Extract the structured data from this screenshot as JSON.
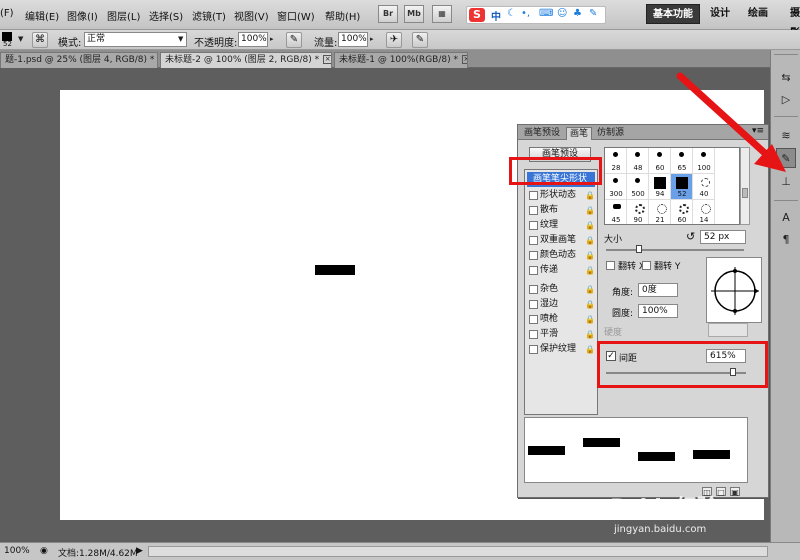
{
  "menubar": {
    "items": [
      "(F)",
      "编辑(E)",
      "图像(I)",
      "图层(L)",
      "选择(S)",
      "滤镜(T)",
      "视图(V)",
      "窗口(W)",
      "帮助(H)"
    ],
    "br_label": "Br",
    "mb_label": "Mb",
    "sogou_mode": "中",
    "workspaces": [
      "基本功能",
      "设计",
      "绘画",
      "摄影"
    ],
    "active_workspace": "基本功能"
  },
  "options": {
    "brush_size": "52",
    "mode_label": "模式:",
    "mode_value": "正常",
    "opacity_label": "不透明度:",
    "opacity_value": "100%",
    "flow_label": "流量:",
    "flow_value": "100%"
  },
  "tabs": [
    {
      "label": "题-1.psd @ 25% (图层 4, RGB/8) *",
      "active": false
    },
    {
      "label": "未标题-2 @ 100% (图层 2, RGB/8) *",
      "active": true
    },
    {
      "label": "未标题-1 @ 100%(RGB/8) *",
      "active": false
    }
  ],
  "brush_panel": {
    "tabs": [
      "画笔预设",
      "画笔",
      "仿制源"
    ],
    "active_tab": "画笔",
    "presets_button": "画笔预设",
    "options": [
      {
        "label": "画笔笔尖形状",
        "checkbox": false,
        "lock": false,
        "selected": true
      },
      {
        "label": "形状动态",
        "checkbox": true,
        "lock": true
      },
      {
        "label": "散布",
        "checkbox": true,
        "lock": true
      },
      {
        "label": "纹理",
        "checkbox": true,
        "lock": true
      },
      {
        "label": "双重画笔",
        "checkbox": true,
        "lock": true
      },
      {
        "label": "颜色动态",
        "checkbox": true,
        "lock": true
      },
      {
        "label": "传递",
        "checkbox": true,
        "lock": true
      },
      {
        "label": "杂色",
        "checkbox": true,
        "lock": true
      },
      {
        "label": "湿边",
        "checkbox": true,
        "lock": true
      },
      {
        "label": "喷枪",
        "checkbox": true,
        "lock": true
      },
      {
        "label": "平滑",
        "checkbox": true,
        "lock": true
      },
      {
        "label": "保护纹理",
        "checkbox": true,
        "lock": true
      }
    ],
    "tips": [
      "28",
      "48",
      "60",
      "65",
      "100",
      "300",
      "500",
      "94",
      "52",
      "40",
      "45",
      "90",
      "21",
      "60",
      "14"
    ],
    "selected_tip": "52",
    "size_label": "大小",
    "size_value": "52 px",
    "flip_x": "翻转 X",
    "flip_y": "翻转 Y",
    "angle_label": "角度:",
    "angle_value": "0度",
    "roundness_label": "圆度:",
    "roundness_value": "100%",
    "hardness_label": "硬度",
    "spacing_label": "间距",
    "spacing_checked": true,
    "spacing_value": "615%"
  },
  "status": {
    "zoom": "100%",
    "doc_info": "文档:1.28M/4.62M"
  },
  "watermark": {
    "logo": "Baidu经验",
    "url": "jingyan.baidu.com"
  }
}
